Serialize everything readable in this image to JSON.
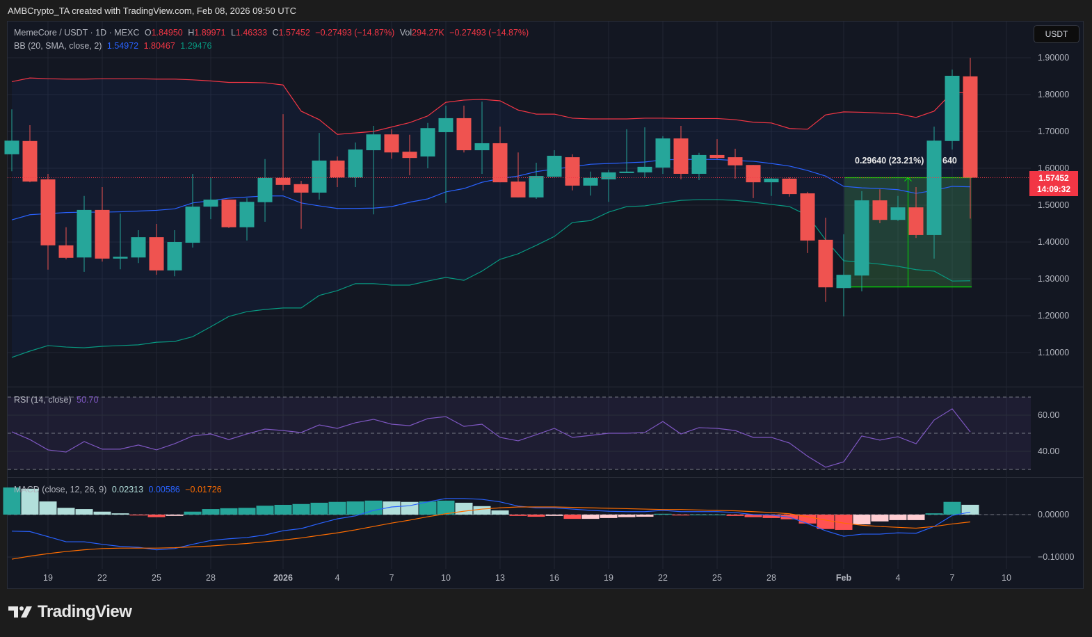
{
  "credit": "AMBCrypto_TA created with TradingView.com, Feb 08, 2026 09:50 UTC",
  "legend": {
    "symbol": "MemeCore / USDT · 1D · MEXC",
    "o_label": "O",
    "o": "1.84950",
    "h_label": "H",
    "h": "1.89971",
    "l_label": "L",
    "l": "1.46333",
    "c_label": "C",
    "c": "1.57452",
    "change": "−0.27493 (−14.87%)",
    "vol_label": "Vol",
    "vol": "294.27K",
    "vol_change": "−0.27493 (−14.87%)",
    "bb_label": "BB (20, SMA, close, 2)",
    "bb_basis": "1.54972",
    "bb_upper": "1.80467",
    "bb_lower": "1.29476",
    "rsi_label": "RSI (14, close)",
    "rsi_value": "50.70",
    "macd_label": "MACD (close, 12, 26, 9)",
    "macd_hist": "0.02313",
    "macd_value": "0.00586",
    "macd_signal": "−0.01726"
  },
  "currency_button": "USDT",
  "last_price": {
    "price": "1.57452",
    "countdown": "14:09:32"
  },
  "measure": {
    "label": "0.29640 (23.21%)",
    "label_tail": "640",
    "from": 1.2781,
    "to": 1.5745,
    "start_index": 46,
    "end_index": 53
  },
  "brand": "TradingView",
  "colors": {
    "up": "#26a69a",
    "down": "#ef5350",
    "bb_upper": "#f23645",
    "bb_basis": "#2962ff",
    "bb_lower": "#089981",
    "rsi": "#7e57c2",
    "macd": "#2962ff",
    "signal": "#ff6d00",
    "measure": "#00e600",
    "last_price": "#f23645"
  },
  "chart_data": [
    {
      "type": "candlestick",
      "title": "MemeCore / USDT · 1D · MEXC",
      "x_tick_labels": [
        "19",
        "22",
        "25",
        "28",
        "2026",
        "4",
        "7",
        "10",
        "13",
        "16",
        "19",
        "22",
        "25",
        "28",
        "Feb",
        "4",
        "7",
        "10"
      ],
      "y_ticks": [
        "1.90000",
        "1.80000",
        "1.70000",
        "1.60000",
        "1.50000",
        "1.40000",
        "1.30000",
        "1.20000",
        "1.10000"
      ],
      "ylim": [
        1.03,
        1.99
      ],
      "grid": true,
      "dates": [
        "Dec 17",
        "Dec 18",
        "Dec 19",
        "Dec 20",
        "Dec 21",
        "Dec 22",
        "Dec 23",
        "Dec 24",
        "Dec 25",
        "Dec 26",
        "Dec 27",
        "Dec 28",
        "Dec 29",
        "Dec 30",
        "Dec 31",
        "Jan 1",
        "Jan 2",
        "Jan 3",
        "Jan 4",
        "Jan 5",
        "Jan 6",
        "Jan 7",
        "Jan 8",
        "Jan 9",
        "Jan 10",
        "Jan 11",
        "Jan 12",
        "Jan 13",
        "Jan 14",
        "Jan 15",
        "Jan 16",
        "Jan 17",
        "Jan 18",
        "Jan 19",
        "Jan 20",
        "Jan 21",
        "Jan 22",
        "Jan 23",
        "Jan 24",
        "Jan 25",
        "Jan 26",
        "Jan 27",
        "Jan 28",
        "Jan 29",
        "Jan 30",
        "Jan 31",
        "Feb 1",
        "Feb 2",
        "Feb 3",
        "Feb 4",
        "Feb 5",
        "Feb 6",
        "Feb 7",
        "Feb 8"
      ],
      "ohlc": [
        [
          1.638,
          1.76,
          1.592,
          1.675
        ],
        [
          1.674,
          1.717,
          1.562,
          1.564
        ],
        [
          1.57,
          1.585,
          1.325,
          1.391
        ],
        [
          1.391,
          1.44,
          1.353,
          1.357
        ],
        [
          1.358,
          1.525,
          1.319,
          1.487
        ],
        [
          1.487,
          1.549,
          1.347,
          1.355
        ],
        [
          1.355,
          1.477,
          1.326,
          1.36
        ],
        [
          1.358,
          1.432,
          1.343,
          1.413
        ],
        [
          1.413,
          1.449,
          1.311,
          1.323
        ],
        [
          1.323,
          1.432,
          1.307,
          1.4
        ],
        [
          1.398,
          1.585,
          1.385,
          1.496
        ],
        [
          1.496,
          1.575,
          1.462,
          1.515
        ],
        [
          1.515,
          1.515,
          1.438,
          1.44
        ],
        [
          1.44,
          1.519,
          1.404,
          1.509
        ],
        [
          1.508,
          1.625,
          1.455,
          1.574
        ],
        [
          1.574,
          1.747,
          1.54,
          1.555
        ],
        [
          1.557,
          1.566,
          1.436,
          1.534
        ],
        [
          1.534,
          1.696,
          1.515,
          1.621
        ],
        [
          1.621,
          1.632,
          1.549,
          1.575
        ],
        [
          1.575,
          1.67,
          1.549,
          1.651
        ],
        [
          1.649,
          1.715,
          1.475,
          1.692
        ],
        [
          1.692,
          1.706,
          1.626,
          1.643
        ],
        [
          1.645,
          1.691,
          1.581,
          1.628
        ],
        [
          1.632,
          1.723,
          1.6,
          1.709
        ],
        [
          1.698,
          1.77,
          1.506,
          1.736
        ],
        [
          1.736,
          1.77,
          1.643,
          1.649
        ],
        [
          1.649,
          1.781,
          1.585,
          1.668
        ],
        [
          1.668,
          1.713,
          1.562,
          1.562
        ],
        [
          1.564,
          1.643,
          1.521,
          1.521
        ],
        [
          1.521,
          1.615,
          1.517,
          1.579
        ],
        [
          1.577,
          1.649,
          1.577,
          1.634
        ],
        [
          1.63,
          1.638,
          1.54,
          1.553
        ],
        [
          1.553,
          1.591,
          1.526,
          1.574
        ],
        [
          1.57,
          1.596,
          1.509,
          1.589
        ],
        [
          1.587,
          1.706,
          1.587,
          1.591
        ],
        [
          1.589,
          1.711,
          1.575,
          1.604
        ],
        [
          1.602,
          1.687,
          1.585,
          1.681
        ],
        [
          1.681,
          1.715,
          1.57,
          1.585
        ],
        [
          1.585,
          1.642,
          1.568,
          1.636
        ],
        [
          1.636,
          1.679,
          1.625,
          1.628
        ],
        [
          1.63,
          1.653,
          1.572,
          1.608
        ],
        [
          1.609,
          1.609,
          1.519,
          1.562
        ],
        [
          1.562,
          1.574,
          1.525,
          1.572
        ],
        [
          1.572,
          1.575,
          1.523,
          1.53
        ],
        [
          1.532,
          1.536,
          1.37,
          1.404
        ],
        [
          1.406,
          1.466,
          1.238,
          1.277
        ],
        [
          1.275,
          1.421,
          1.198,
          1.311
        ],
        [
          1.309,
          1.538,
          1.266,
          1.513
        ],
        [
          1.513,
          1.543,
          1.451,
          1.46
        ],
        [
          1.46,
          1.525,
          1.457,
          1.494
        ],
        [
          1.494,
          1.549,
          1.411,
          1.419
        ],
        [
          1.419,
          1.713,
          1.355,
          1.675
        ],
        [
          1.674,
          1.868,
          1.651,
          1.851
        ],
        [
          1.8495,
          1.89971,
          1.46333,
          1.57452
        ]
      ],
      "series": [
        {
          "name": "BB upper",
          "values": [
            1.835,
            1.845,
            1.843,
            1.842,
            1.842,
            1.843,
            1.843,
            1.843,
            1.842,
            1.842,
            1.84,
            1.837,
            1.833,
            1.833,
            1.832,
            1.826,
            1.755,
            1.732,
            1.692,
            1.696,
            1.7,
            1.712,
            1.724,
            1.742,
            1.779,
            1.785,
            1.787,
            1.783,
            1.758,
            1.747,
            1.747,
            1.736,
            1.734,
            1.734,
            1.734,
            1.736,
            1.736,
            1.735,
            1.735,
            1.735,
            1.732,
            1.725,
            1.723,
            1.708,
            1.706,
            1.745,
            1.753,
            1.752,
            1.75,
            1.748,
            1.738,
            1.755,
            1.806,
            1.80467
          ]
        },
        {
          "name": "BB basis",
          "values": [
            1.46,
            1.474,
            1.477,
            1.48,
            1.481,
            1.481,
            1.482,
            1.484,
            1.486,
            1.49,
            1.506,
            1.512,
            1.519,
            1.522,
            1.525,
            1.525,
            1.506,
            1.498,
            1.491,
            1.491,
            1.492,
            1.496,
            1.508,
            1.517,
            1.536,
            1.545,
            1.562,
            1.572,
            1.579,
            1.591,
            1.598,
            1.604,
            1.611,
            1.613,
            1.615,
            1.617,
            1.623,
            1.624,
            1.624,
            1.624,
            1.621,
            1.619,
            1.613,
            1.606,
            1.594,
            1.579,
            1.551,
            1.547,
            1.545,
            1.542,
            1.532,
            1.54,
            1.551,
            1.54972
          ]
        },
        {
          "name": "BB lower",
          "values": [
            1.087,
            1.104,
            1.119,
            1.115,
            1.113,
            1.117,
            1.119,
            1.121,
            1.128,
            1.13,
            1.143,
            1.17,
            1.198,
            1.211,
            1.217,
            1.221,
            1.221,
            1.255,
            1.268,
            1.287,
            1.287,
            1.283,
            1.283,
            1.294,
            1.304,
            1.296,
            1.321,
            1.353,
            1.368,
            1.391,
            1.415,
            1.453,
            1.458,
            1.481,
            1.496,
            1.498,
            1.506,
            1.513,
            1.515,
            1.515,
            1.513,
            1.508,
            1.502,
            1.496,
            1.472,
            1.406,
            1.349,
            1.345,
            1.34,
            1.334,
            1.325,
            1.321,
            1.294,
            1.29476
          ]
        }
      ]
    },
    {
      "type": "line",
      "title": "RSI (14, close)",
      "y_ticks": [
        "60.00",
        "40.00"
      ],
      "ylim": [
        22,
        81
      ],
      "bands": [
        70,
        50,
        30
      ],
      "series": [
        {
          "name": "RSI",
          "values": [
            50.8,
            46.5,
            40.8,
            39.6,
            45.4,
            41.2,
            41.2,
            43.5,
            40.8,
            44.2,
            48.5,
            49.6,
            46.5,
            49.6,
            52.3,
            51.5,
            50.4,
            54.6,
            52.7,
            55.8,
            57.7,
            55.0,
            54.2,
            58.1,
            59.2,
            53.8,
            55.0,
            47.7,
            45.8,
            49.2,
            52.7,
            47.7,
            48.8,
            50.0,
            50.0,
            50.4,
            56.5,
            49.6,
            53.1,
            52.7,
            51.5,
            47.7,
            47.7,
            44.6,
            37.3,
            31.2,
            34.2,
            48.5,
            46.2,
            48.1,
            44.2,
            57.3,
            63.5,
            50.7
          ]
        }
      ]
    },
    {
      "type": "bar+line",
      "title": "MACD (close, 12, 26, 9)",
      "y_ticks": [
        "0.00000",
        "−0.10000"
      ],
      "ylim": [
        -0.128,
        0.075
      ],
      "series": [
        {
          "name": "Histogram",
          "values": [
            0.064,
            0.061,
            0.031,
            0.016,
            0.013,
            0.007,
            0.003,
            -0.002,
            -0.006,
            -0.003,
            0.007,
            0.013,
            0.015,
            0.016,
            0.021,
            0.023,
            0.025,
            0.028,
            0.03,
            0.031,
            0.033,
            0.031,
            0.03,
            0.031,
            0.033,
            0.028,
            0.02,
            0.01,
            -0.003,
            -0.005,
            -0.003,
            -0.01,
            -0.01,
            -0.008,
            -0.006,
            -0.005,
            0.002,
            -0.002,
            0.0,
            0.0,
            -0.003,
            -0.006,
            -0.008,
            -0.011,
            -0.021,
            -0.034,
            -0.036,
            -0.023,
            -0.016,
            -0.013,
            -0.013,
            0.003,
            0.03,
            0.02313
          ]
        },
        {
          "name": "MACD",
          "values": [
            -0.039,
            -0.04,
            -0.052,
            -0.064,
            -0.064,
            -0.07,
            -0.075,
            -0.077,
            -0.083,
            -0.08,
            -0.07,
            -0.061,
            -0.057,
            -0.054,
            -0.048,
            -0.038,
            -0.033,
            -0.021,
            -0.01,
            -0.003,
            0.01,
            0.018,
            0.021,
            0.03,
            0.038,
            0.038,
            0.036,
            0.03,
            0.02,
            0.016,
            0.016,
            0.013,
            0.01,
            0.008,
            0.007,
            0.007,
            0.01,
            0.007,
            0.007,
            0.007,
            0.005,
            0.0,
            -0.001,
            -0.006,
            -0.021,
            -0.038,
            -0.051,
            -0.046,
            -0.046,
            -0.043,
            -0.044,
            -0.028,
            -0.002,
            0.00586
          ]
        },
        {
          "name": "Signal",
          "values": [
            -0.105,
            -0.098,
            -0.092,
            -0.087,
            -0.083,
            -0.08,
            -0.079,
            -0.079,
            -0.079,
            -0.078,
            -0.076,
            -0.074,
            -0.071,
            -0.068,
            -0.064,
            -0.06,
            -0.055,
            -0.049,
            -0.043,
            -0.036,
            -0.028,
            -0.02,
            -0.013,
            -0.005,
            0.002,
            0.008,
            0.013,
            0.016,
            0.018,
            0.018,
            0.018,
            0.017,
            0.016,
            0.015,
            0.014,
            0.013,
            0.012,
            0.012,
            0.011,
            0.01,
            0.009,
            0.007,
            0.005,
            0.002,
            -0.005,
            -0.013,
            -0.02,
            -0.025,
            -0.028,
            -0.03,
            -0.032,
            -0.028,
            -0.022,
            -0.01726
          ]
        }
      ]
    }
  ]
}
